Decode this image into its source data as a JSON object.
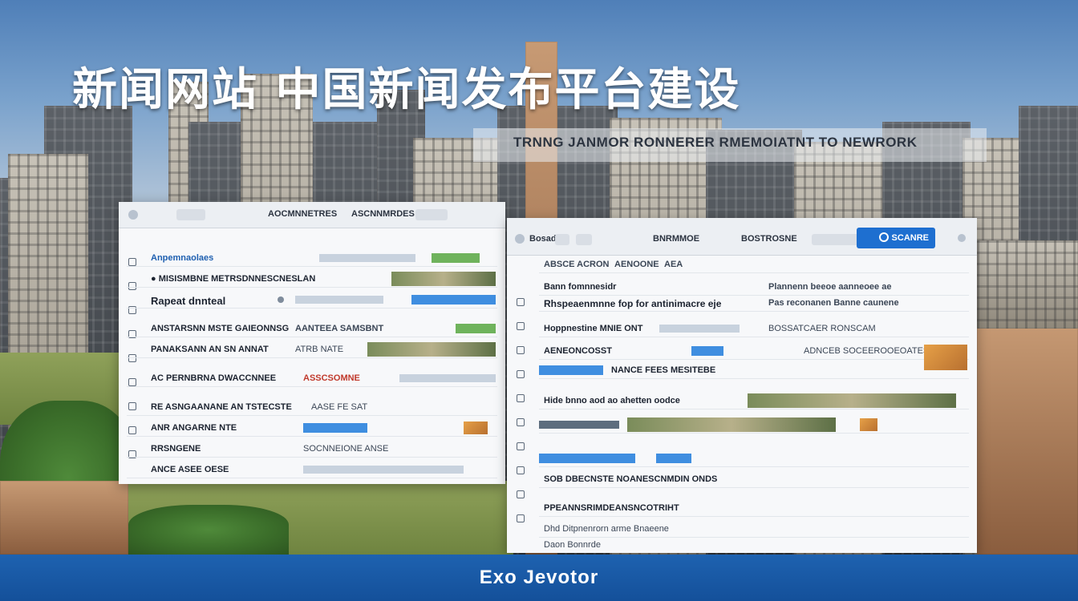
{
  "headline": "新闻网站 中国新闻发布平台建设",
  "subheadline": "TRNNG JANMOR RONNERER RMEMOIATNT TO NEWRORK",
  "footer": "Exo Jevotor",
  "left_window": {
    "toolbar": [
      "●",
      "AOCMNNETRES",
      "ASCNNMRDES"
    ],
    "rows": [
      "Anpemnaolaes",
      "● MISISMBNE METRSDNNESCNESLAN",
      "Rapeat dnnteal",
      "ANSTARSNN MSTE GAIEONNSG",
      "PANAKSANN AN SN ANNAT",
      "AC PERNBRNA DWACCNNEE",
      "RE ASNGAANANE AN TSTECSTE",
      "ANR ANGARNE NTE",
      "RRSNGENE",
      "ANCE ASEE OESE"
    ],
    "right_rows": [
      "AANTEEA SAMSBNT",
      "ATRB NATE",
      "ASSCSOMNE",
      "AASE FE SAT",
      "SOCNNEIONE ANSE"
    ]
  },
  "right_window": {
    "toolbar": [
      "Bosad",
      "BNRMMOE",
      "BOSTROSNE"
    ],
    "search_label": "SCANRE",
    "tabs": [
      "ABSCE ACRON",
      "AENOONE",
      "AEA"
    ],
    "rows": [
      "Bann fomnnesidr",
      "Rhspeaenmnne fop for antinimacre eje",
      "Hoppnestine MNIE ONT",
      "AENEONCOSST",
      "NANCE FEES MESITEBE",
      "Hide bnno aod ao ahetten oodce",
      "SOB DBECNSTE NOANESCNMDIN ONDS",
      "PPEANNSRIMDEANSNCOTRIHT",
      "Dhd Ditpnenrorn arme Bnaeene",
      "Daon Bonnrde"
    ],
    "right_rows": [
      "Plannenn beeoe aanneoee ae",
      "Pas reconanen Banne caunene",
      "BOSSATCAER  RONSCAM",
      "ADNCEB SOCEEROOEOATES"
    ]
  }
}
